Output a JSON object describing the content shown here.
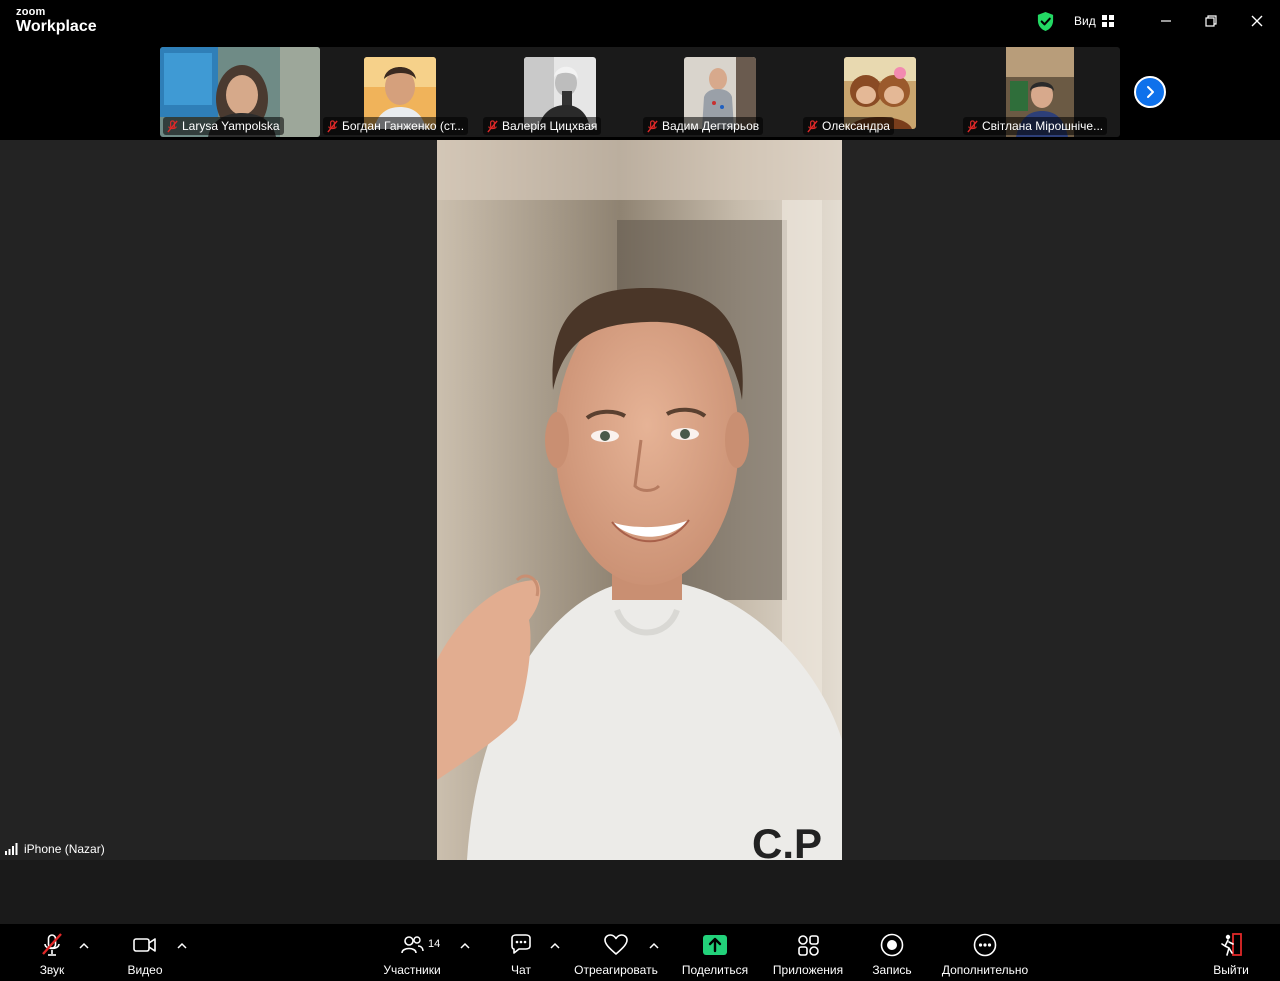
{
  "app": {
    "logo_small": "zoom",
    "logo_big": "Workplace",
    "view_label": "Вид"
  },
  "colors": {
    "accent_blue": "#0e71eb",
    "share_green": "#22d17a",
    "mute_red": "#e02828",
    "leave_red": "#e02828",
    "shield_green": "#23d964"
  },
  "participants_strip": [
    {
      "name": "Larysa Yampolska",
      "muted": true,
      "video": true
    },
    {
      "name": "Богдан Ганженко (ст...",
      "muted": true,
      "video": false
    },
    {
      "name": "Валерія Цицхвая",
      "muted": true,
      "video": false
    },
    {
      "name": "Вадим Дегтярьов",
      "muted": true,
      "video": false
    },
    {
      "name": "Олександра",
      "muted": true,
      "video": false
    },
    {
      "name": "Світлана Мірошніче...",
      "muted": true,
      "video": true
    }
  ],
  "main_speaker": {
    "name": "iPhone (Nazar)",
    "shirt_text": "C.P"
  },
  "toolbar": {
    "audio": "Звук",
    "video": "Видео",
    "participants": "Участники",
    "participants_count": "14",
    "chat": "Чат",
    "react": "Отреагировать",
    "share": "Поделиться",
    "apps": "Приложения",
    "record": "Запись",
    "more": "Дополнительно",
    "leave": "Выйти"
  }
}
